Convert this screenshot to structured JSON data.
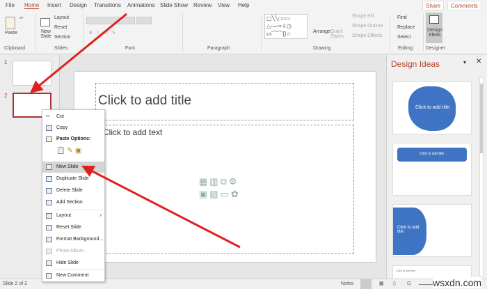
{
  "tabs": [
    "File",
    "Home",
    "Insert",
    "Design",
    "Transitions",
    "Animations",
    "Slide Show",
    "Review",
    "View",
    "Help"
  ],
  "header": {
    "share": "Share",
    "comments": "Comments"
  },
  "ribbon": {
    "clipboard": {
      "label": "Clipboard",
      "paste": "Paste"
    },
    "slides": {
      "label": "Slides",
      "new_slide": "New Slide",
      "layout": "Layout",
      "reset": "Reset",
      "section": "Section"
    },
    "font": {
      "label": "Font",
      "bold": "B",
      "italic": "I",
      "underline": "U",
      "strike": "S"
    },
    "paragraph": {
      "label": "Paragraph"
    },
    "drawing": {
      "label": "Drawing",
      "arrange": "Arrange",
      "quick_styles": "Quick Styles",
      "shape_fill": "Shape Fill",
      "shape_outline": "Shape Outline",
      "shape_effects": "Shape Effects"
    },
    "editing": {
      "label": "Editing",
      "find": "Find",
      "replace": "Replace",
      "select": "Select"
    },
    "designer": {
      "label": "Designer",
      "design_ideas": "Design Ideas"
    }
  },
  "thumbnails": [
    {
      "num": "1"
    },
    {
      "num": "2"
    }
  ],
  "slide": {
    "title_placeholder": "Click to add title",
    "text_placeholder": "Click to add text"
  },
  "context_menu": [
    {
      "label": "Cut"
    },
    {
      "label": "Copy"
    },
    {
      "label": "Paste Options:"
    },
    {
      "label": "New Slide",
      "highlighted": true
    },
    {
      "label": "Duplicate Slide"
    },
    {
      "label": "Delete Slide"
    },
    {
      "label": "Add Section"
    },
    {
      "label": "Layout"
    },
    {
      "label": "Reset Slide"
    },
    {
      "label": "Format Background..."
    },
    {
      "label": "Photo Album...",
      "disabled": true
    },
    {
      "label": "Hide Slide"
    },
    {
      "label": "New Comment"
    }
  ],
  "design_ideas": {
    "title": "Design Ideas",
    "cards": [
      "Click to add title",
      "Click to add title",
      "Click to add title",
      "Click to add title"
    ]
  },
  "status": {
    "slide": "Slide 2 of 2",
    "notes": "Notes",
    "watermark": "wsxdn.com"
  },
  "colors": {
    "accent": "#b7472a",
    "arrow": "#e02020",
    "blob": "#3f74c5"
  }
}
